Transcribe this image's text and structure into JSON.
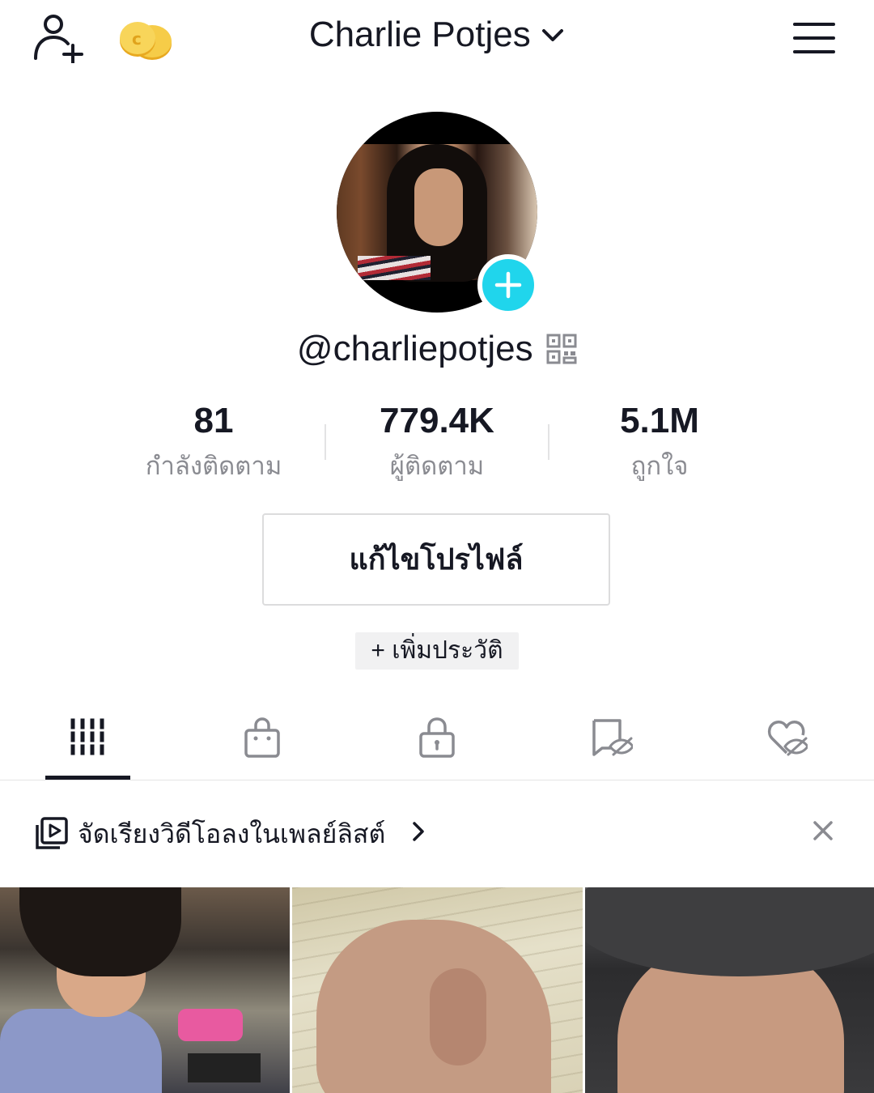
{
  "header": {
    "title": "Charlie Potjes",
    "add_user_icon": "add-user-icon",
    "coins_icon": "coins-icon",
    "menu_icon": "hamburger-menu-icon"
  },
  "profile": {
    "username": "@charliepotjes",
    "stats": [
      {
        "value": "81",
        "label": "กำลังติดตาม"
      },
      {
        "value": "779.4K",
        "label": "ผู้ติดตาม"
      },
      {
        "value": "5.1M",
        "label": "ถูกใจ"
      }
    ],
    "edit_button": "แก้ไขโปรไฟล์",
    "add_bio": "+ เพิ่มประวัติ"
  },
  "tabs": [
    {
      "icon": "videos-grid-icon",
      "active": true
    },
    {
      "icon": "shop-bag-icon",
      "active": false
    },
    {
      "icon": "lock-icon",
      "active": false
    },
    {
      "icon": "bookmark-hidden-icon",
      "active": false
    },
    {
      "icon": "heart-hidden-icon",
      "active": false
    }
  ],
  "playlist_banner": {
    "text": "จัดเรียงวิดีโอลงในเพลย์ลิสต์"
  },
  "colors": {
    "accent": "#20d5ec",
    "text": "#161823",
    "muted": "#8a8b91",
    "coins": "#f2c23d"
  }
}
